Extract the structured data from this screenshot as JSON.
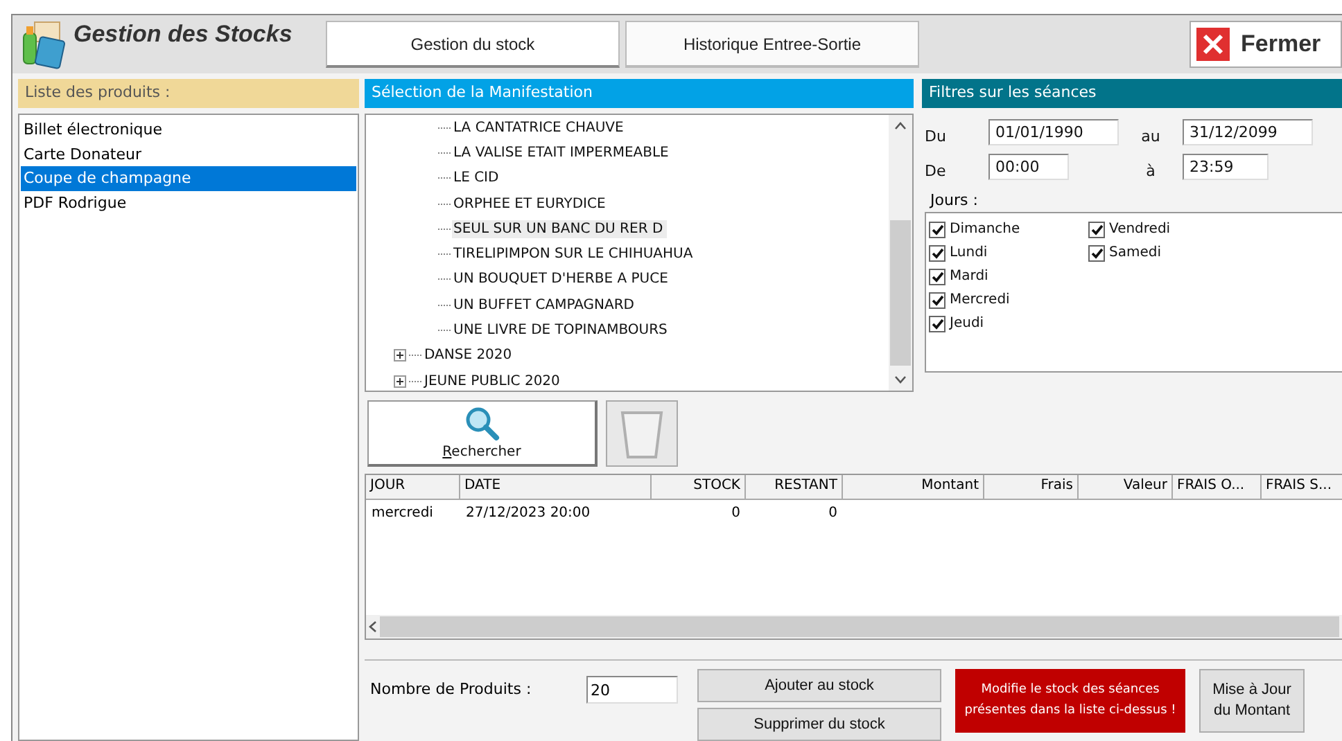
{
  "window": {
    "title": "Gestion des Stocks"
  },
  "tabs": [
    {
      "label": "Gestion du stock",
      "selected": true
    },
    {
      "label": "Historique Entree-Sortie",
      "selected": false
    }
  ],
  "close_button": {
    "label": "Fermer"
  },
  "products": {
    "title": "Liste des produits :",
    "items": [
      {
        "label": "Billet électronique",
        "selected": false
      },
      {
        "label": "Carte Donateur",
        "selected": false
      },
      {
        "label": "Coupe de champagne",
        "selected": true
      },
      {
        "label": "PDF Rodrigue",
        "selected": false
      }
    ]
  },
  "manifestation": {
    "title": "Sélection de la Manifestation",
    "nodes": [
      {
        "children": [
          {
            "label": "LA CANTATRICE CHAUVE",
            "selected": false
          },
          {
            "label": "LA VALISE ETAIT IMPERMEABLE",
            "selected": false
          },
          {
            "label": "LE CID",
            "selected": false
          },
          {
            "label": "ORPHEE ET EURYDICE",
            "selected": false
          },
          {
            "label": "SEUL SUR UN BANC DU RER D",
            "selected": true
          },
          {
            "label": "TIRELIPIMPON SUR LE CHIHUAHUA",
            "selected": false
          },
          {
            "label": "UN BOUQUET D'HERBE A PUCE",
            "selected": false
          },
          {
            "label": "UN BUFFET CAMPAGNARD",
            "selected": false
          },
          {
            "label": "UNE LIVRE DE TOPINAMBOURS",
            "selected": false
          }
        ]
      },
      {
        "label": "DANSE 2020",
        "expanded": false,
        "selected": false
      },
      {
        "label": "JEUNE PUBLIC 2020",
        "expanded": false,
        "selected": false
      }
    ]
  },
  "filters": {
    "title": "Filtres sur les séances",
    "date_from": {
      "label": "Du",
      "value": "01/01/1990"
    },
    "date_to": {
      "label": "au",
      "value": "31/12/2099"
    },
    "time_from": {
      "label": "De",
      "value": "00:00"
    },
    "time_to": {
      "label": "à",
      "value": "23:59"
    },
    "days_label": "Jours  :",
    "days": [
      {
        "label": "Dimanche",
        "checked": true
      },
      {
        "label": "Lundi",
        "checked": true
      },
      {
        "label": "Mardi",
        "checked": true
      },
      {
        "label": "Mercredi",
        "checked": true
      },
      {
        "label": "Jeudi",
        "checked": true
      },
      {
        "label": "Vendredi",
        "checked": true
      },
      {
        "label": "Samedi",
        "checked": true
      }
    ]
  },
  "search_button": {
    "label": "Rechercher"
  },
  "clear_button": {
    "disabled": true
  },
  "table": {
    "columns": [
      {
        "label": "JOUR",
        "kind": "text"
      },
      {
        "label": "DATE",
        "kind": "text"
      },
      {
        "label": "STOCK",
        "kind": "number"
      },
      {
        "label": "RESTANT",
        "kind": "number"
      },
      {
        "label": "Montant",
        "kind": "number"
      },
      {
        "label": "Frais",
        "kind": "number"
      },
      {
        "label": "Valeur",
        "kind": "number"
      },
      {
        "label": "FRAIS O...",
        "kind": "text"
      },
      {
        "label": "FRAIS S...",
        "kind": "text"
      }
    ],
    "rows": [
      {
        "cells": [
          "mercredi",
          "27/12/2023 20:00",
          "0",
          "0"
        ]
      }
    ]
  },
  "quantity": {
    "label": "Nombre de Produits :",
    "value": "20"
  },
  "add_button": {
    "label": "Ajouter au stock"
  },
  "remove_button": {
    "label": "Supprimer du stock"
  },
  "notice": "Modifie le stock des séances présentes dans la liste ci-dessus !",
  "update_button": {
    "label": "Mise à Jour du Montant"
  }
}
